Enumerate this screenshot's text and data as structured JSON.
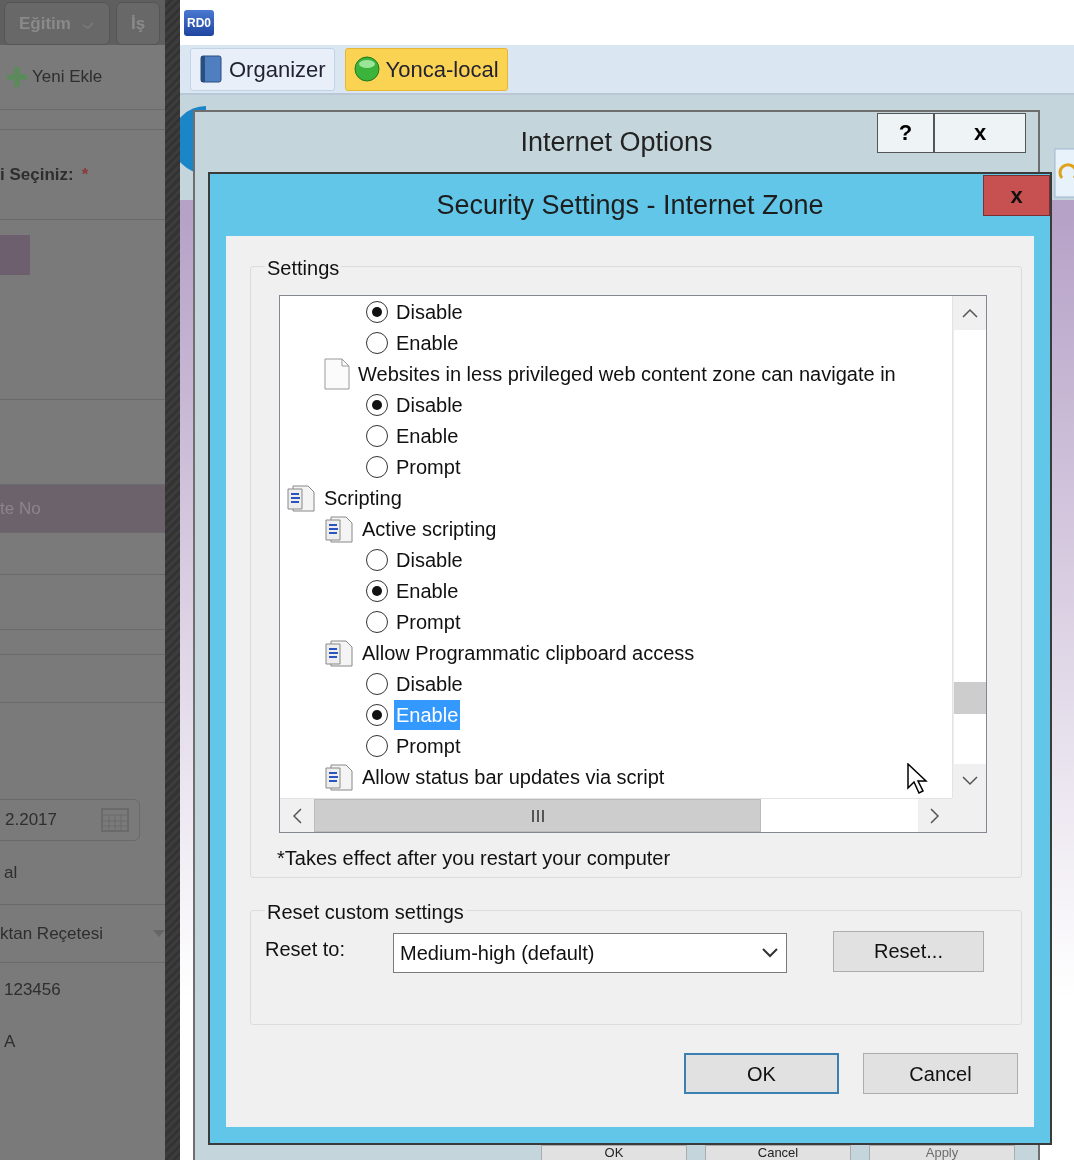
{
  "background_app": {
    "tabs": [
      {
        "label": "Eğitim"
      },
      {
        "label": "İş"
      }
    ],
    "toolbar_button": "Yeni Ekle",
    "field_label": "i Seçiniz:",
    "required_mark": "*",
    "table_header": "te No",
    "date_field": "2.2017",
    "text_1": "al",
    "dropdown": "ktan Reçetesi",
    "number": "123456",
    "text_2": "A"
  },
  "app": {
    "logo": "RD0",
    "tabs": [
      {
        "label": "Organizer",
        "selected": false
      },
      {
        "label": "Yonca-local",
        "selected": true
      }
    ]
  },
  "internet_options": {
    "title": "Internet Options",
    "title_buttons": [
      "?",
      "x"
    ],
    "buttons": [
      {
        "label": "OK",
        "disabled": false
      },
      {
        "label": "Cancel",
        "disabled": false
      },
      {
        "label": "Apply",
        "disabled": true
      }
    ]
  },
  "security_dialog": {
    "title": "Security Settings - Internet Zone",
    "close": "x",
    "settings_label": "Settings",
    "tree": [
      {
        "kind": "radio",
        "label": "Disable",
        "checked": true,
        "selected": false
      },
      {
        "kind": "radio",
        "label": "Enable",
        "checked": false,
        "selected": false
      },
      {
        "kind": "document",
        "label": "Websites in less privileged web content zone can navigate in",
        "children": [
          {
            "kind": "radio",
            "label": "Disable",
            "checked": true,
            "selected": false
          },
          {
            "kind": "radio",
            "label": "Enable",
            "checked": false,
            "selected": false
          },
          {
            "kind": "radio",
            "label": "Prompt",
            "checked": false,
            "selected": false
          }
        ]
      },
      {
        "kind": "category",
        "label": "Scripting",
        "children": [
          {
            "kind": "script",
            "label": "Active scripting",
            "children": [
              {
                "kind": "radio",
                "label": "Disable",
                "checked": false,
                "selected": false
              },
              {
                "kind": "radio",
                "label": "Enable",
                "checked": true,
                "selected": false
              },
              {
                "kind": "radio",
                "label": "Prompt",
                "checked": false,
                "selected": false
              }
            ]
          },
          {
            "kind": "script",
            "label": "Allow Programmatic clipboard access",
            "children": [
              {
                "kind": "radio",
                "label": "Disable",
                "checked": false,
                "selected": false
              },
              {
                "kind": "radio",
                "label": "Enable",
                "checked": true,
                "selected": true
              },
              {
                "kind": "radio",
                "label": "Prompt",
                "checked": false,
                "selected": false
              }
            ]
          },
          {
            "kind": "script",
            "label": "Allow status bar updates via script"
          }
        ]
      }
    ],
    "note": "*Takes effect after you restart your computer",
    "reset_label": "Reset custom settings",
    "reset_to_label": "Reset to:",
    "reset_to": "Medium-high (default)",
    "reset_button": "Reset...",
    "buttons": [
      {
        "label": "OK",
        "default": true
      },
      {
        "label": "Cancel",
        "default": false
      }
    ]
  }
}
